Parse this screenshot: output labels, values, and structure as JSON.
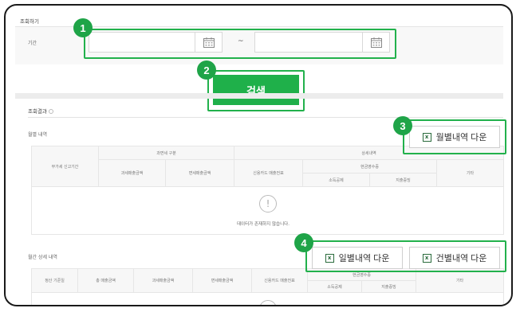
{
  "search_section": {
    "title": "조회하기",
    "period_label": "기간",
    "start_date_placeholder": "",
    "end_date_placeholder": "",
    "range_separator": "~",
    "helper_text": "",
    "search_button": "검색"
  },
  "results_section": {
    "title": "조회결과",
    "monthly": {
      "title": "월별 내역",
      "download_button": "월별내역 다운",
      "headers": {
        "group_tax": "과면세 구분",
        "group_detail": "상세내역",
        "group_cash": "현금영수증",
        "period": "부가세 신고기간",
        "taxable": "과세매출금액",
        "tax_free": "면세매출금액",
        "credit_card": "신용카드 매출전표",
        "income_deduction": "소득공제",
        "expense_proof": "지출증빙",
        "other": "기타"
      },
      "empty_message": "데이터가 존재하지 않습니다."
    },
    "detail": {
      "title": "월간 상세 내역",
      "daily_download_button": "일별내역 다운",
      "item_download_button": "건별내역 다운",
      "headers": {
        "settle_date": "정산 기준일",
        "total_sales": "총 매출금액",
        "taxable": "과세매출금액",
        "tax_free": "면세매출금액",
        "credit_card": "신용카드 매출전표",
        "group_cash": "현금영수증",
        "income_deduction": "소득공제",
        "expense_proof": "지출증빙",
        "other": "기타"
      }
    }
  },
  "callouts": [
    "1",
    "2",
    "3",
    "4"
  ],
  "icons": {
    "calendar": "calendar-icon",
    "excel": "excel-icon",
    "info": "info-icon",
    "alert": "exclamation-icon"
  },
  "colors": {
    "accent_green": "#1fb04a",
    "callout_border": "#22b14c",
    "frame_border": "#1a1a1a"
  }
}
